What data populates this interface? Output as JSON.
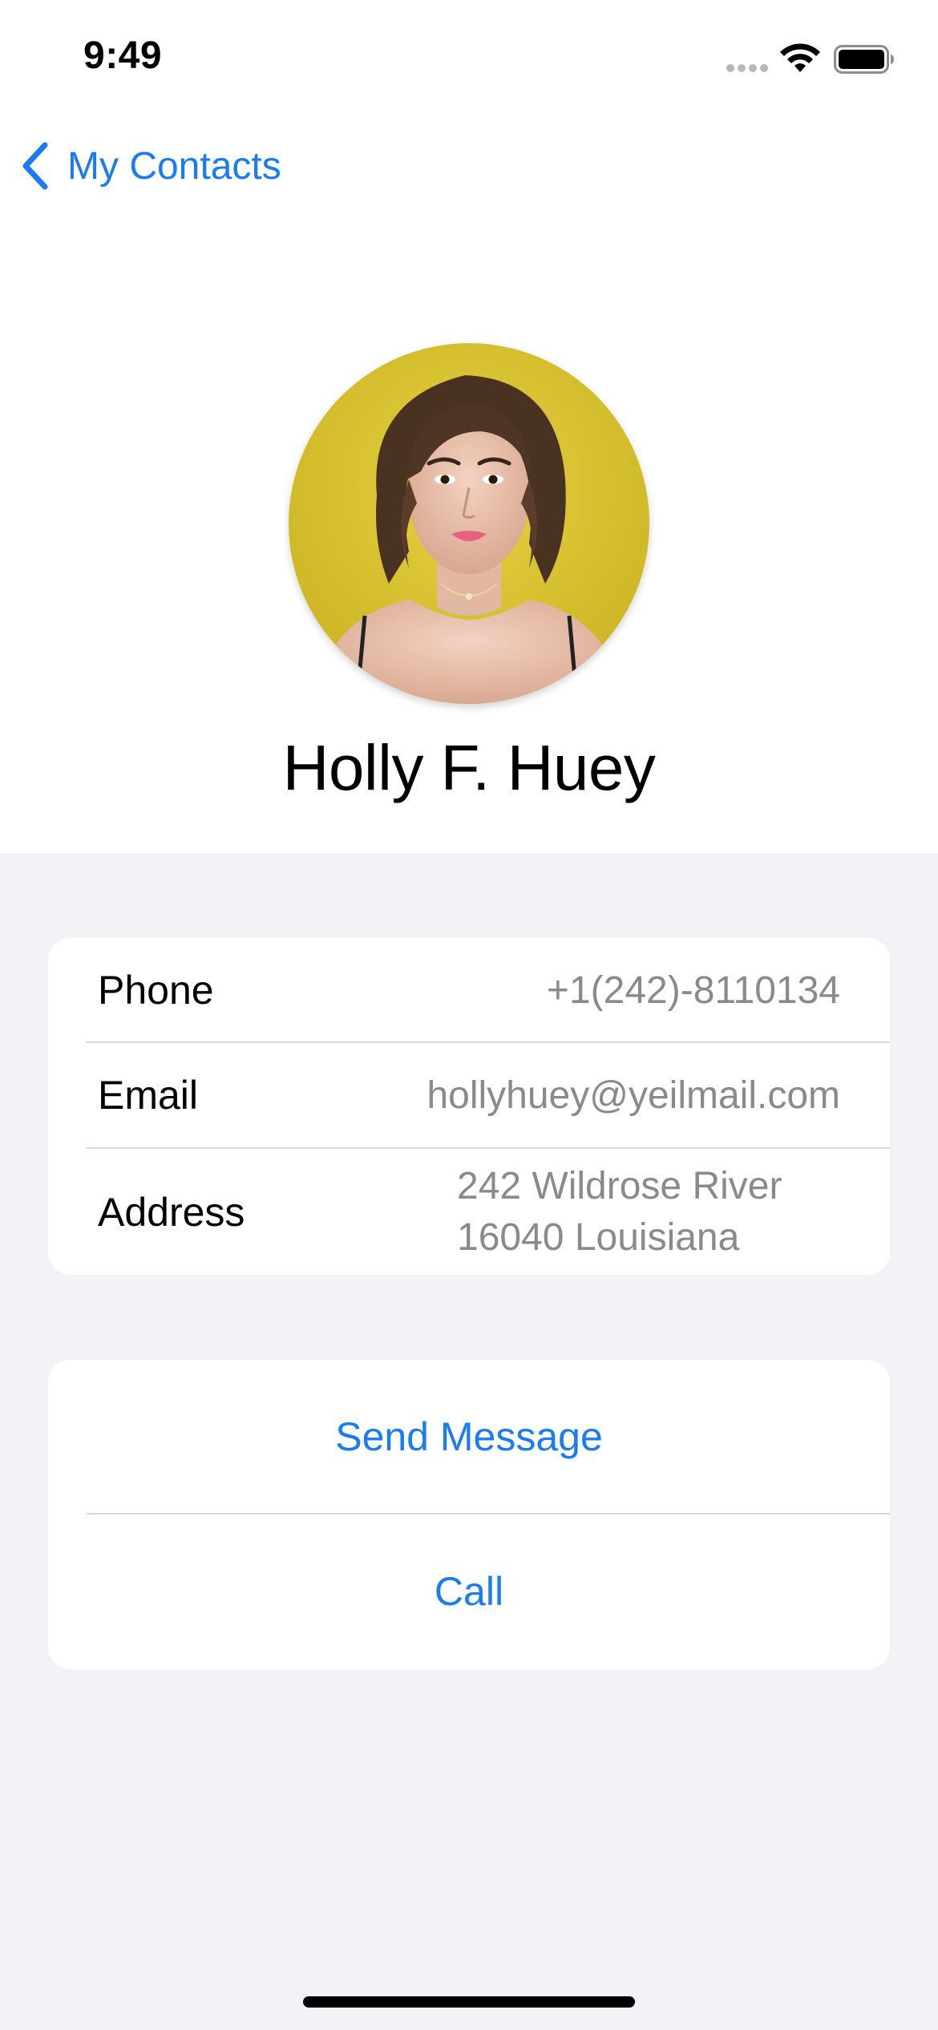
{
  "status_bar": {
    "time": "9:49"
  },
  "nav": {
    "back_label": "My Contacts",
    "accent_color": "#1a7cf2"
  },
  "contact": {
    "name": "Holly F. Huey",
    "avatar_icon": "person-photo"
  },
  "details": [
    {
      "label": "Phone",
      "value": "+1(242)-8110134"
    },
    {
      "label": "Email",
      "value": "hollyhuey@yeilmail.com"
    },
    {
      "label": "Address",
      "value_lines": [
        "242 Wildrose River",
        "16040 Louisiana"
      ]
    }
  ],
  "actions": {
    "send_message": "Send Message",
    "call": "Call"
  },
  "colors": {
    "background": "#f2f2f7",
    "card": "#ffffff",
    "secondary_text": "#8a8a8e"
  }
}
